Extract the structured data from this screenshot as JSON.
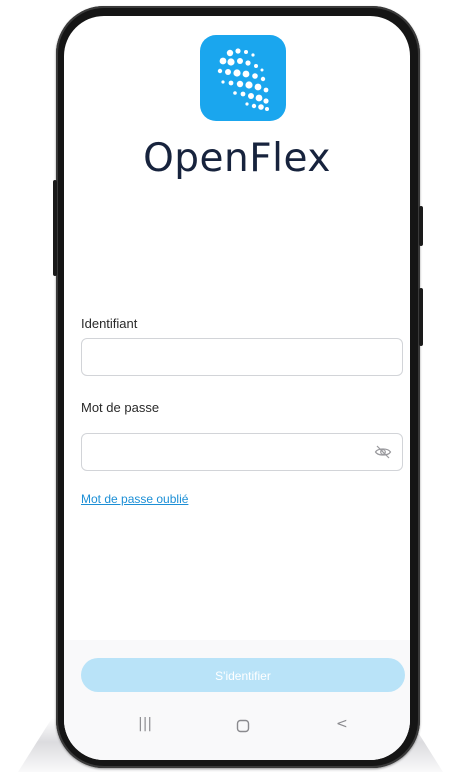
{
  "app": {
    "brand_name": "OpenFlex",
    "logo_icon": "dotted-wave-logo-icon",
    "accent_color": "#1aa6ee"
  },
  "form": {
    "username_label": "Identifiant",
    "username_value": "",
    "password_label": "Mot de passe",
    "password_value": "",
    "password_toggle_icon": "eye-slash-icon",
    "forgot_password_link": "Mot de passe oublié",
    "submit_label": "S'identifier",
    "submit_state": "disabled"
  },
  "system_nav": {
    "recent_apps_icon": "recent-apps-icon",
    "recent_glyph": "|||",
    "home_icon": "home-icon",
    "back_icon": "back-icon",
    "back_glyph": "<"
  }
}
